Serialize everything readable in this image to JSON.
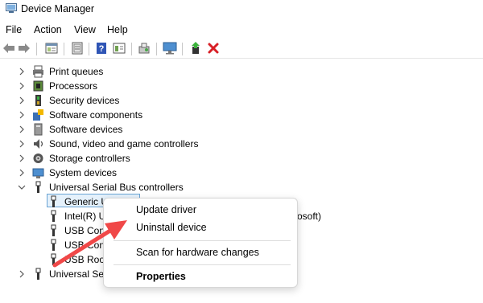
{
  "window": {
    "title": "Device Manager"
  },
  "menu": [
    "File",
    "Action",
    "View",
    "Help"
  ],
  "toolbar": {
    "icons": [
      "back-arrow-icon",
      "forward-arrow-icon",
      "properties-icon",
      "show-hidden-icon",
      "help-icon",
      "view-icon",
      "scan-hardware-icon",
      "computer-monitor-icon",
      "update-driver-icon",
      "uninstall-icon"
    ]
  },
  "tree": {
    "categories": [
      {
        "label": "Print queues",
        "icon": "printer-icon"
      },
      {
        "label": "Processors",
        "icon": "processor-icon"
      },
      {
        "label": "Security devices",
        "icon": "security-device-icon"
      },
      {
        "label": "Software components",
        "icon": "software-component-icon"
      },
      {
        "label": "Software devices",
        "icon": "software-device-icon"
      },
      {
        "label": "Sound, video and game controllers",
        "icon": "speaker-icon"
      },
      {
        "label": "Storage controllers",
        "icon": "storage-controller-icon"
      },
      {
        "label": "System devices",
        "icon": "system-device-icon"
      },
      {
        "label": "Universal Serial Bus controllers",
        "icon": "usb-icon"
      }
    ],
    "usb_children": [
      {
        "label": "Generic U",
        "icon": "usb-icon"
      },
      {
        "label": "Intel(R) U",
        "icon": "usb-icon"
      },
      {
        "label": "USB Con",
        "icon": "usb-icon"
      },
      {
        "label": "USB Con",
        "icon": "usb-icon"
      },
      {
        "label": "USB Root",
        "icon": "usb-icon"
      }
    ],
    "partial_text": "osoft)",
    "last_category": {
      "label": "Universal Seri",
      "icon": "usb-icon"
    }
  },
  "context_menu": {
    "items": [
      "Update driver",
      "Uninstall device",
      "Scan for hardware changes",
      "Properties"
    ]
  },
  "colors": {
    "selection_fill": "#e5f1fb",
    "selection_border": "#6aa4d4",
    "annotation_arrow": "#f04848",
    "uninstall_red": "#d81f26"
  }
}
